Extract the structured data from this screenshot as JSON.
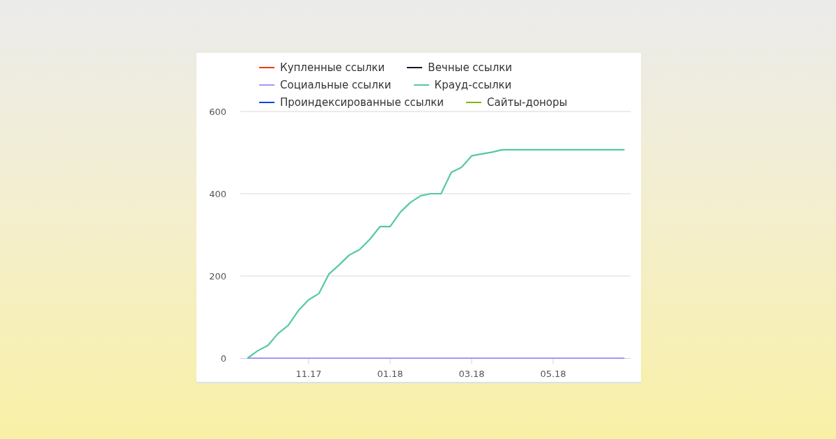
{
  "chart_data": {
    "type": "line",
    "categories": [
      null,
      null,
      null,
      null,
      null,
      null,
      "11.17",
      null,
      null,
      null,
      null,
      null,
      null,
      null,
      "01.18",
      null,
      null,
      null,
      null,
      null,
      null,
      null,
      "03.18",
      null,
      null,
      null,
      null,
      null,
      null,
      null,
      "05.18",
      null,
      null,
      null,
      null,
      null,
      null,
      null
    ],
    "legend": "top",
    "ylim": [
      0,
      600
    ],
    "yticks": [
      0,
      200,
      400,
      600
    ],
    "series": [
      {
        "name": "Купленные ссылки",
        "color": "#ff3300",
        "values": [
          null,
          null,
          null,
          null,
          null,
          null,
          null,
          null,
          null,
          null,
          null,
          null,
          null,
          null,
          null,
          null,
          null,
          null,
          null,
          null,
          null,
          null,
          null,
          null,
          null,
          null,
          null,
          null,
          null,
          null,
          null,
          null,
          null,
          null,
          null,
          null,
          null,
          null
        ]
      },
      {
        "name": "Вечные ссылки",
        "color": "#0d1b2a",
        "values": [
          null,
          null,
          null,
          null,
          null,
          null,
          null,
          null,
          null,
          null,
          null,
          null,
          null,
          null,
          null,
          null,
          null,
          null,
          null,
          null,
          null,
          null,
          null,
          null,
          null,
          null,
          null,
          null,
          null,
          null,
          null,
          null,
          null,
          null,
          null,
          null,
          null,
          null
        ]
      },
      {
        "name": "Социальные ссылки",
        "color": "#a995f2",
        "values": [
          0,
          0,
          0,
          0,
          0,
          0,
          0,
          0,
          0,
          0,
          0,
          0,
          0,
          0,
          0,
          0,
          0,
          0,
          0,
          0,
          0,
          0,
          0,
          0,
          0,
          0,
          0,
          0,
          0,
          0,
          0,
          0,
          0,
          0,
          0,
          0,
          0,
          0
        ]
      },
      {
        "name": "Крауд-ссылки",
        "color": "#55c9a0",
        "values": [
          0,
          18,
          31,
          60,
          80,
          116,
          142,
          157,
          205,
          227,
          251,
          264,
          289,
          320,
          320,
          355,
          379,
          395,
          400,
          400,
          452,
          464,
          492,
          497,
          501,
          507,
          507,
          507,
          507,
          507,
          507,
          507,
          507,
          507,
          507,
          507,
          507,
          507
        ]
      },
      {
        "name": "Проиндексированные ссылки",
        "color": "#0044ee",
        "values": [
          null,
          null,
          null,
          null,
          null,
          null,
          null,
          null,
          null,
          null,
          null,
          null,
          null,
          null,
          null,
          null,
          null,
          null,
          null,
          null,
          null,
          null,
          null,
          null,
          null,
          null,
          null,
          null,
          null,
          null,
          null,
          null,
          null,
          null,
          null,
          null,
          null,
          null
        ]
      },
      {
        "name": "Сайты-доноры",
        "color": "#7ab800",
        "values": [
          null,
          null,
          null,
          null,
          null,
          null,
          null,
          null,
          null,
          null,
          null,
          null,
          null,
          null,
          null,
          null,
          null,
          null,
          null,
          null,
          null,
          null,
          null,
          null,
          null,
          null,
          null,
          null,
          null,
          null,
          null,
          null,
          null,
          null,
          null,
          null,
          null,
          null
        ]
      }
    ]
  }
}
